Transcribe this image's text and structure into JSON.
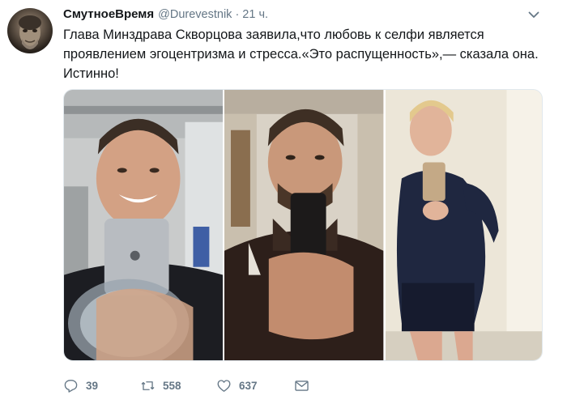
{
  "tweet": {
    "display_name": "СмутноеВремя",
    "handle": "@Durevestnik",
    "separator": "·",
    "time": "21 ч.",
    "text": "Глава Минздрава Скворцова заявила,что любовь к селфи является проявлением эгоцентризма и стресса.«Это распущенность»,— сказала она. Истинно!",
    "media": [
      {
        "description_icon": "photo-selfie-gym"
      },
      {
        "description_icon": "photo-selfie-jacket"
      },
      {
        "description_icon": "photo-selfie-sportswear"
      }
    ],
    "actions": {
      "reply_count": "39",
      "retweet_count": "558",
      "like_count": "637"
    }
  },
  "colors": {
    "text": "#14171a",
    "secondary": "#657786",
    "border": "#e1e8ed"
  }
}
